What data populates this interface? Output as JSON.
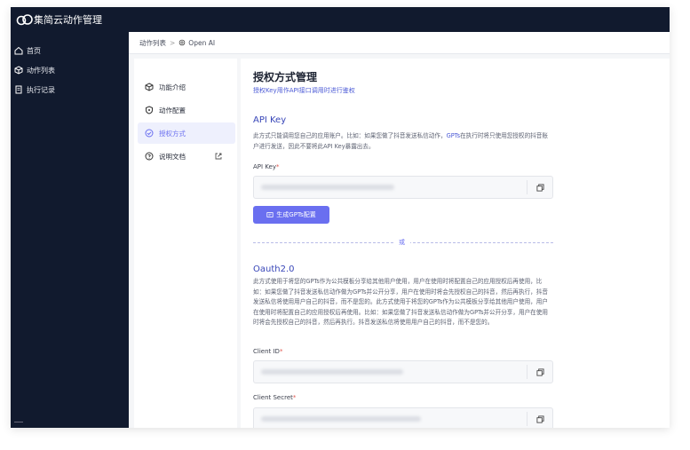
{
  "app": {
    "title": "集简云动作管理"
  },
  "sidebar": {
    "items": [
      {
        "label": "首页",
        "icon": "home-icon"
      },
      {
        "label": "动作列表",
        "icon": "cube-icon"
      },
      {
        "label": "执行记录",
        "icon": "document-icon"
      }
    ]
  },
  "breadcrumb": {
    "root": "动作列表",
    "sep": ">",
    "current": "Open AI"
  },
  "subnav": {
    "items": [
      {
        "label": "功能介绍",
        "icon": "cube-icon"
      },
      {
        "label": "动作配置",
        "icon": "shield-icon"
      },
      {
        "label": "授权方式",
        "icon": "check-circle-icon",
        "active": true
      },
      {
        "label": "说明文档",
        "icon": "help-circle-icon",
        "external": true
      }
    ]
  },
  "content": {
    "title": "授权方式管理",
    "subtitle": "授权Key用作API接口调用时进行鉴权",
    "api_key": {
      "heading": "API Key",
      "desc_before": "此方式只能调用您自己的应用账户。比如：如果您做了抖音发送私信动作，",
      "desc_highlight": "GPTs",
      "desc_after": "在执行时将只使用您授权的抖音账户进行发送，因此不要将此API Key暴露出去。",
      "field_label": "API Key",
      "required_mark": "*",
      "generate_button": "生成GPTs配置"
    },
    "divider_text": "或",
    "oauth": {
      "heading": "Oauth2.0",
      "desc": "此方式使用于将您的GPTs作为公共模板分享给其他用户使用，用户在使用时将配置自己的应用授权后再使用，比如：如果您做了抖音发送私信动作做为GPTs并公开分享，用户在使用时将会先授权自己的抖音，然后再执行，抖音发送私信将使用用户自己的抖音，而不是您的。此方式使用于将您的GPTs作为公共模板分享给其他用户使用，用户在使用时将配置自己的应用授权后再使用。比如：如果您做了抖音发送私信动作做为GPTs并公开分享，用户在使用时将会先授权自己的抖音，然后再执行。抖音发送私信将使用用户自己的抖音，而不是您的。",
      "client_id_label": "Client ID",
      "client_secret_label": "Client Secret",
      "required_mark": "*"
    }
  },
  "colors": {
    "accent": "#6a6ff0",
    "sidebar": "#111a2e"
  }
}
